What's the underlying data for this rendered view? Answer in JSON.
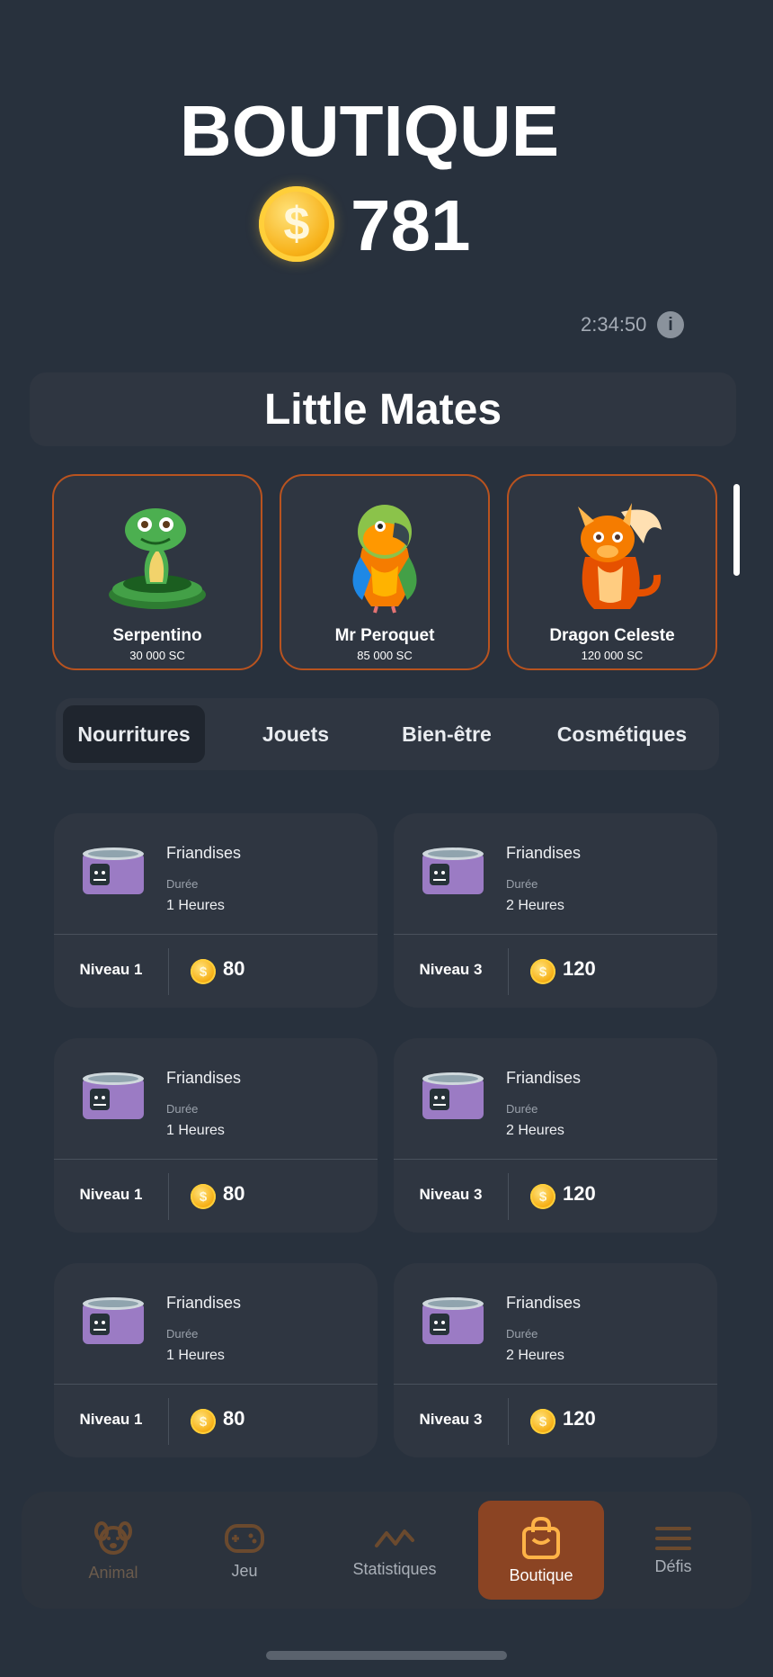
{
  "header": {
    "title": "BOUTIQUE",
    "balance": "781",
    "timer": "2:34:50"
  },
  "section": {
    "title": "Little Mates"
  },
  "pets": [
    {
      "name": "Serpentino",
      "price": "30 000 SC",
      "icon": "snake-icon"
    },
    {
      "name": "Mr Peroquet",
      "price": "85 000 SC",
      "icon": "parrot-icon"
    },
    {
      "name": "Dragon Celeste",
      "price": "120 000 SC",
      "icon": "dragon-icon"
    }
  ],
  "tabs": [
    {
      "label": "Nourritures",
      "active": true
    },
    {
      "label": "Jouets",
      "active": false
    },
    {
      "label": "Bien-être",
      "active": false
    },
    {
      "label": "Cosmétiques",
      "active": false
    }
  ],
  "items": [
    {
      "name": "Friandises",
      "duration_label": "Durée",
      "duration": "1 Heures",
      "level": "Niveau 1",
      "price": "80"
    },
    {
      "name": "Friandises",
      "duration_label": "Durée",
      "duration": "2 Heures",
      "level": "Niveau 3",
      "price": "120"
    },
    {
      "name": "Friandises",
      "duration_label": "Durée",
      "duration": "1 Heures",
      "level": "Niveau 1",
      "price": "80"
    },
    {
      "name": "Friandises",
      "duration_label": "Durée",
      "duration": "2 Heures",
      "level": "Niveau 3",
      "price": "120"
    },
    {
      "name": "Friandises",
      "duration_label": "Durée",
      "duration": "1 Heures",
      "level": "Niveau 1",
      "price": "80"
    },
    {
      "name": "Friandises",
      "duration_label": "Durée",
      "duration": "2 Heures",
      "level": "Niveau 3",
      "price": "120"
    }
  ],
  "nav": [
    {
      "label": "Animal",
      "icon": "dog-icon",
      "active": false
    },
    {
      "label": "Jeu",
      "icon": "gamepad-icon",
      "active": false
    },
    {
      "label": "Statistiques",
      "icon": "stats-icon",
      "active": false
    },
    {
      "label": "Boutique",
      "icon": "shopping-bag-icon",
      "active": true
    },
    {
      "label": "Défis",
      "icon": "menu-icon",
      "active": false
    }
  ],
  "colors": {
    "background": "#28313d",
    "card": "#2f3641",
    "accent": "#b9531f",
    "nav_active": "#8b4423",
    "coin": "#f7b21a"
  }
}
